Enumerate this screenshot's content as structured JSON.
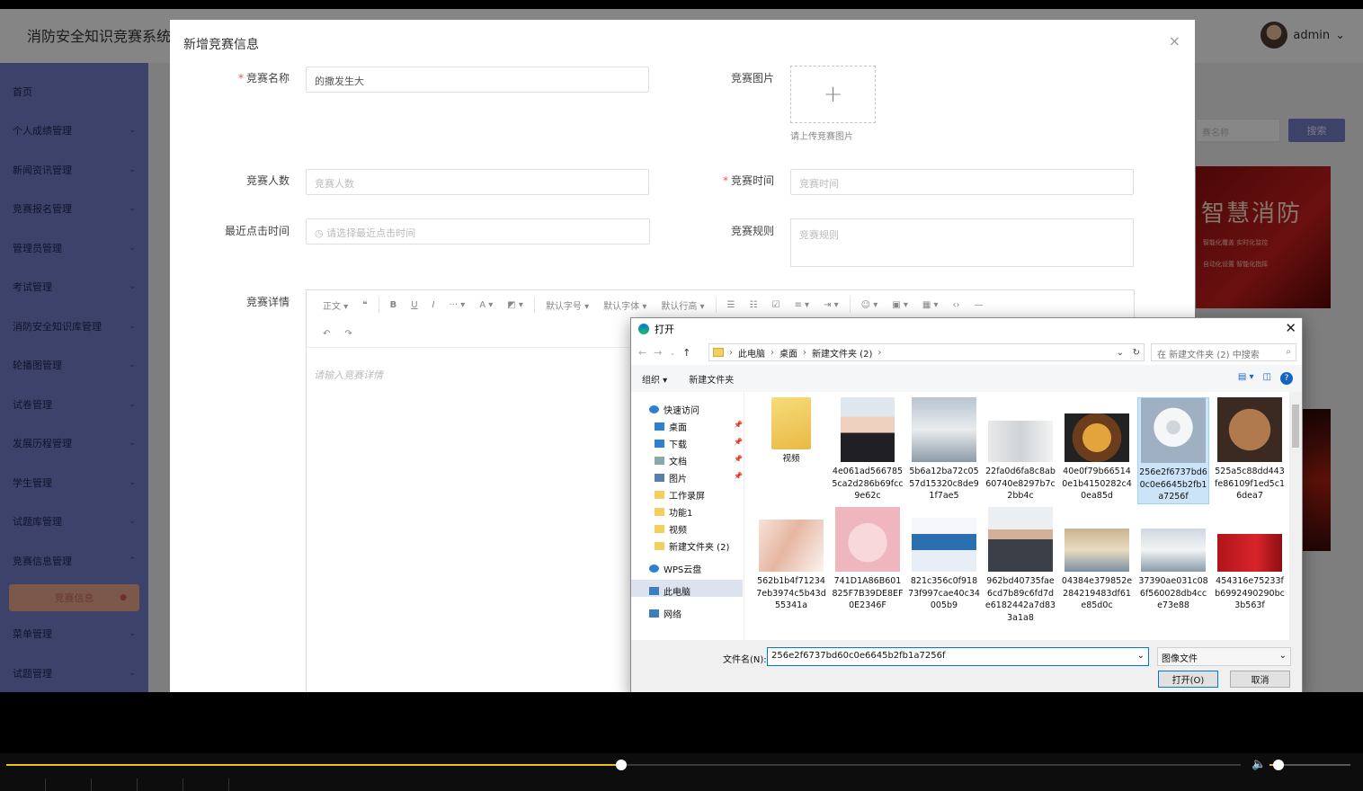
{
  "app": {
    "title": "消防安全知识竞赛系统",
    "user": "admin"
  },
  "sidebar": {
    "items": [
      {
        "label": "首页",
        "chev": ""
      },
      {
        "label": "个人成绩管理",
        "chev": "⌄"
      },
      {
        "label": "新闻资讯管理",
        "chev": "⌄"
      },
      {
        "label": "竞赛报名管理",
        "chev": "⌄"
      },
      {
        "label": "管理员管理",
        "chev": "⌄"
      },
      {
        "label": "考试管理",
        "chev": "⌄"
      },
      {
        "label": "消防安全知识库管理",
        "chev": "⌄"
      },
      {
        "label": "轮播图管理",
        "chev": "⌄"
      },
      {
        "label": "试卷管理",
        "chev": "⌄"
      },
      {
        "label": "发展历程管理",
        "chev": "⌄"
      },
      {
        "label": "学生管理",
        "chev": "⌄"
      },
      {
        "label": "试题库管理",
        "chev": "⌄"
      },
      {
        "label": "竞赛信息管理",
        "chev": "⌃"
      }
    ],
    "active_sub": "竞赛信息",
    "items_after": [
      {
        "label": "菜单管理",
        "chev": "⌄"
      },
      {
        "label": "试题管理",
        "chev": "⌄"
      }
    ]
  },
  "background": {
    "search_placeholder": "赛名称",
    "search_button": "搜索",
    "card_title": "智慧消防",
    "card_line1": "智能化覆盖    实时化监控",
    "card_line2": "自动化设置    智能化指挥"
  },
  "dialog": {
    "title": "新增竞赛信息",
    "close": "×",
    "fields": {
      "name_label": "竞赛名称",
      "name_value": "的撒发生大",
      "image_label": "竞赛图片",
      "image_tip": "请上传竞赛图片",
      "count_label": "竞赛人数",
      "count_placeholder": "竞赛人数",
      "time_label": "竞赛时间",
      "time_placeholder": "竞赛时间",
      "click_label": "最近点击时间",
      "click_placeholder": "请选择最近点击时间",
      "rules_label": "竞赛规则",
      "rules_placeholder": "竞赛规则",
      "detail_label": "竞赛详情",
      "detail_placeholder": "请输入竞赛详情"
    },
    "toolbar": {
      "paragraph": "正文",
      "font_size": "默认字号",
      "font_family": "默认字体",
      "line_height": "默认行高"
    }
  },
  "file_dialog": {
    "title": "打开",
    "breadcrumb": [
      "此电脑",
      "桌面",
      "新建文件夹 (2)"
    ],
    "search_placeholder": "在 新建文件夹 (2) 中搜索",
    "organize": "组织 ▾",
    "new_folder": "新建文件夹",
    "tree": [
      {
        "label": "快速访问",
        "icon": "star-icon",
        "pin": false
      },
      {
        "label": "桌面",
        "icon": "desktop-icon",
        "pin": true
      },
      {
        "label": "下载",
        "icon": "download-icon",
        "pin": true
      },
      {
        "label": "文档",
        "icon": "document-icon",
        "pin": true
      },
      {
        "label": "图片",
        "icon": "picture-icon",
        "pin": true
      },
      {
        "label": "工作录屏",
        "icon": "folder-icon",
        "pin": false
      },
      {
        "label": "功能1",
        "icon": "folder-icon",
        "pin": false
      },
      {
        "label": "视频",
        "icon": "folder-icon",
        "pin": false
      },
      {
        "label": "新建文件夹 (2)",
        "icon": "folder-icon",
        "pin": false
      },
      {
        "label": "WPS云盘",
        "icon": "cloud-icon",
        "pin": false
      },
      {
        "label": "此电脑",
        "icon": "pc-icon",
        "pin": false
      },
      {
        "label": "网络",
        "icon": "network-icon",
        "pin": false
      }
    ],
    "files": [
      {
        "name": "视频",
        "kind": "folder"
      },
      {
        "name": "4e061ad5667855ca2d286b69fcc9e62c",
        "kind": "portrait"
      },
      {
        "name": "5b6a12ba72c0557d15320c8de91f7ae5",
        "kind": "room"
      },
      {
        "name": "22fa0d6fa8c8ab60740e8297b7c2bb4c",
        "kind": "machine"
      },
      {
        "name": "40e0f79b665140e1b4150282c40ea85d",
        "kind": "food"
      },
      {
        "name": "256e2f6737bd60c0e6645b2fb1a7256f",
        "kind": "scanner",
        "selected": true
      },
      {
        "name": "525a5c88dd443fe86109f1ed5c16dea7",
        "kind": "face"
      },
      {
        "name": "562b1b4f712347eb3974c5b43d55341a",
        "kind": "spa"
      },
      {
        "name": "741D1A86B601825F7B39DE8EF0E2346F",
        "kind": "anime"
      },
      {
        "name": "821c356c0f91873f997cae40c34005b9",
        "kind": "box"
      },
      {
        "name": "962bd40735fae6cd7b89c6fd7de6182442a7d833a1a8",
        "kind": "man"
      },
      {
        "name": "04384e379852e284219483df61e85d0c",
        "kind": "ward"
      },
      {
        "name": "37390ae031c086f560028db4cce73e88",
        "kind": "hospital"
      },
      {
        "name": "454316e75233fb6992490290bc3b563f",
        "kind": "cert"
      }
    ],
    "filename_label": "文件名(N):",
    "filename_value": "256e2f6737bd60c0e6645b2fb1a7256f",
    "filetype": "图像文件",
    "open_button": "打开(O)",
    "cancel_button": "取消"
  },
  "player": {
    "progress": 0.498,
    "volume": 0.11
  }
}
